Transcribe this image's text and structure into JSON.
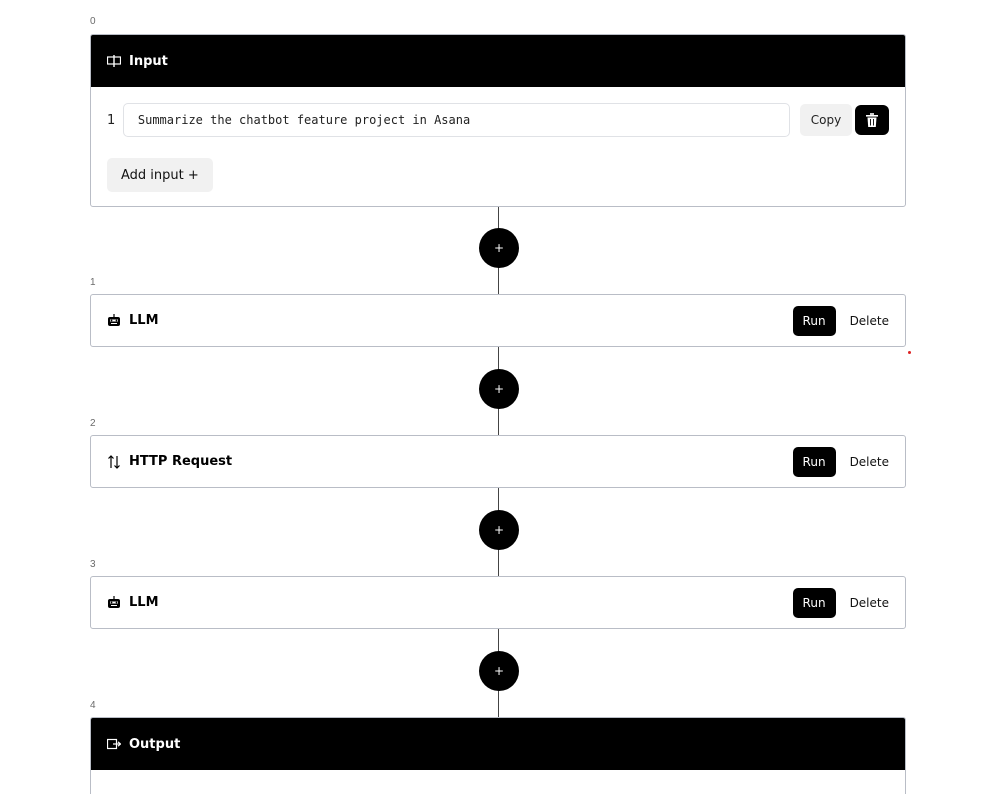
{
  "steps": {
    "step0_index": "0",
    "step1_index": "1",
    "step2_index": "2",
    "step3_index": "3",
    "step4_index": "4"
  },
  "input_block": {
    "title": "Input",
    "icon": "input-icon",
    "rows": [
      {
        "number": "1",
        "value": "Summarize the chatbot feature project in Asana"
      }
    ],
    "copy_label": "Copy",
    "trash_icon": "trash-icon",
    "add_input_label": "Add input +"
  },
  "connector": {
    "add_label": "+"
  },
  "nodes": [
    {
      "title": "LLM",
      "icon": "robot-icon",
      "run_label": "Run",
      "delete_label": "Delete"
    },
    {
      "title": "HTTP Request",
      "icon": "arrows-up-down-icon",
      "run_label": "Run",
      "delete_label": "Delete"
    },
    {
      "title": "LLM",
      "icon": "robot-icon",
      "run_label": "Run",
      "delete_label": "Delete"
    }
  ],
  "output_block": {
    "title": "Output",
    "icon": "output-icon"
  },
  "colors": {
    "header_bg": "#000000",
    "border": "#b9bdc6",
    "button_light": "#f1f1f1"
  }
}
